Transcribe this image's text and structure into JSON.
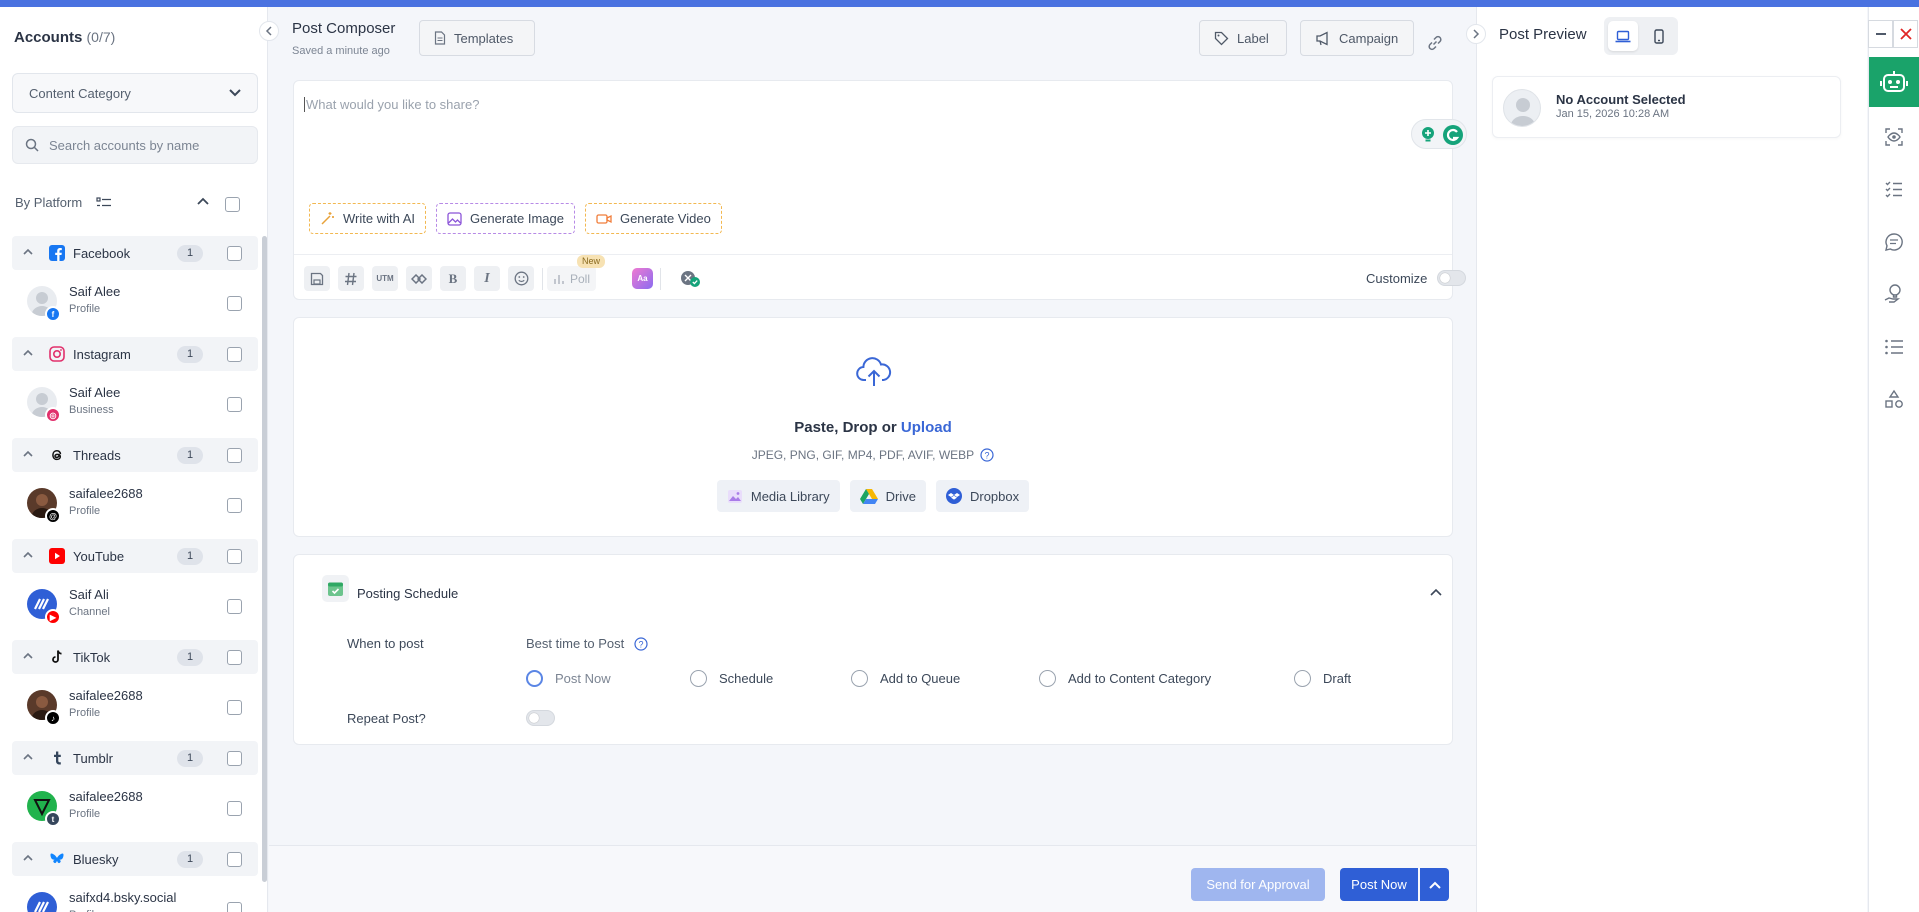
{
  "accounts_panel": {
    "title": "Accounts",
    "count": "(0/7)",
    "category_select": "Content Category",
    "search_placeholder": "Search accounts by name",
    "by_platform": "By Platform",
    "platforms": [
      {
        "name": "Facebook",
        "count": "1",
        "color": "#1877f2",
        "account": {
          "name": "Saif Alee",
          "type": "Profile"
        }
      },
      {
        "name": "Instagram",
        "count": "1",
        "color": "#e1306c",
        "account": {
          "name": "Saif Alee",
          "type": "Business"
        }
      },
      {
        "name": "Threads",
        "count": "1",
        "color": "#000000",
        "account": {
          "name": "saifalee2688",
          "type": "Profile"
        }
      },
      {
        "name": "YouTube",
        "count": "1",
        "color": "#ff0000",
        "account": {
          "name": "Saif Ali",
          "type": "Channel"
        }
      },
      {
        "name": "TikTok",
        "count": "1",
        "color": "#000000",
        "account": {
          "name": "saifalee2688",
          "type": "Profile"
        }
      },
      {
        "name": "Tumblr",
        "count": "1",
        "color": "#35465c",
        "account": {
          "name": "saifalee2688",
          "type": "Profile"
        }
      },
      {
        "name": "Bluesky",
        "count": "1",
        "color": "#1185fe",
        "account": {
          "name": "saifxd4.bsky.social",
          "type": "Profile"
        }
      }
    ]
  },
  "composer": {
    "title": "Post Composer",
    "saved": "Saved a minute ago",
    "templates_label": "Templates",
    "label_btn": "Label",
    "campaign_btn": "Campaign",
    "editor_placeholder": "What would you like to share?",
    "write_ai": "Write with AI",
    "gen_image": "Generate Image",
    "gen_video": "Generate Video",
    "toolbar": {
      "utm": "UTM",
      "bold": "B",
      "italic": "I",
      "poll": "Poll",
      "new_badge": "New",
      "customize": "Customize"
    },
    "upload": {
      "title_prefix": "Paste, Drop or ",
      "upload_link": "Upload",
      "formats": "JPEG, PNG, GIF, MP4, PDF, AVIF, WEBP",
      "media_library": "Media Library",
      "drive": "Drive",
      "dropbox": "Dropbox"
    },
    "schedule": {
      "title": "Posting Schedule",
      "when_label": "When to post",
      "best_time": "Best time to Post",
      "options": [
        "Post Now",
        "Schedule",
        "Add to Queue",
        "Add to Content Category",
        "Draft"
      ],
      "selected": "Post Now",
      "repeat_label": "Repeat Post?"
    },
    "send_approval": "Send for Approval",
    "post_now": "Post Now"
  },
  "preview": {
    "title": "Post Preview",
    "account_name": "No Account Selected",
    "date": "Jan 15, 2026 10:28 AM"
  },
  "colors": {
    "accent": "#2f5fd6",
    "brand_green": "#1aa36a",
    "topbar": "#4a72e0"
  }
}
